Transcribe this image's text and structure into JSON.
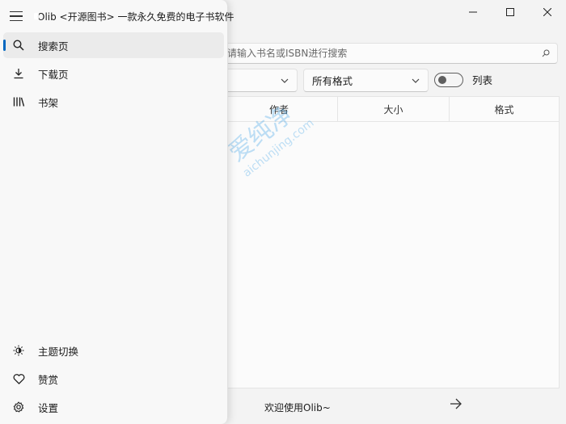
{
  "app": {
    "title": "Olib <开源图书> 一款永久免费的电子书软件"
  },
  "nav": {
    "items": [
      {
        "label": "搜索页",
        "icon": "search-icon"
      },
      {
        "label": "下载页",
        "icon": "download-icon"
      },
      {
        "label": "书架",
        "icon": "bookshelf-icon"
      }
    ],
    "bottom_items": [
      {
        "label": "主题切换",
        "icon": "brightness-icon"
      },
      {
        "label": "赞赏",
        "icon": "heart-icon"
      },
      {
        "label": "设置",
        "icon": "gear-icon"
      }
    ],
    "selected_index": 0
  },
  "search": {
    "placeholder": "请输入书名或ISBN进行搜索",
    "value": ""
  },
  "filters": {
    "language_value": "",
    "format_value": "所有格式",
    "list_toggle_label": "列表",
    "list_toggle_on": false
  },
  "table": {
    "columns": [
      "作者",
      "大小",
      "格式"
    ],
    "rows": []
  },
  "footer": {
    "welcome": "欢迎使用Olib~"
  },
  "watermark": {
    "text_cn": "爱纯净",
    "text_en": "aichunjing.com"
  },
  "colors": {
    "accent": "#0067c0",
    "watermark": "#4aa8e8"
  }
}
